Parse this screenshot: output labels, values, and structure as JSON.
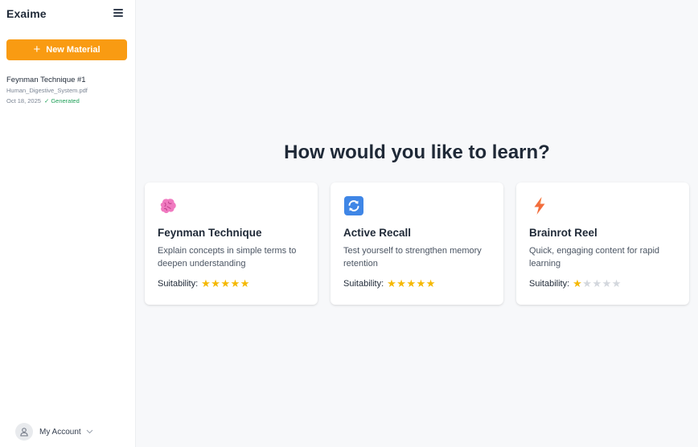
{
  "app": {
    "title": "Exaime"
  },
  "sidebar": {
    "new_button_label": "New Material",
    "materials": [
      {
        "title": "Feynman Technique #1",
        "file": "Human_Digestive_System.pdf",
        "date": "Oct 18, 2025",
        "status": "✓ Generated"
      }
    ],
    "account_label": "My Account"
  },
  "main": {
    "heading": "How would you like to learn?",
    "suitability_label": "Suitability:",
    "cards": [
      {
        "title": "Feynman Technique",
        "description": "Explain concepts in simple terms to deepen understanding",
        "icon": "brain-icon",
        "suitability": 5
      },
      {
        "title": "Active Recall",
        "description": "Test yourself to strengthen memory retention",
        "icon": "refresh-icon",
        "suitability": 5
      },
      {
        "title": "Brainrot Reel",
        "description": "Quick, engaging content for rapid learning",
        "icon": "lightning-icon",
        "suitability": 1
      }
    ],
    "max_stars": 5
  },
  "colors": {
    "accent": "#F99B12",
    "star_on": "#F5B800",
    "star_off": "#D3D7DD",
    "status_green": "#22A15A"
  }
}
